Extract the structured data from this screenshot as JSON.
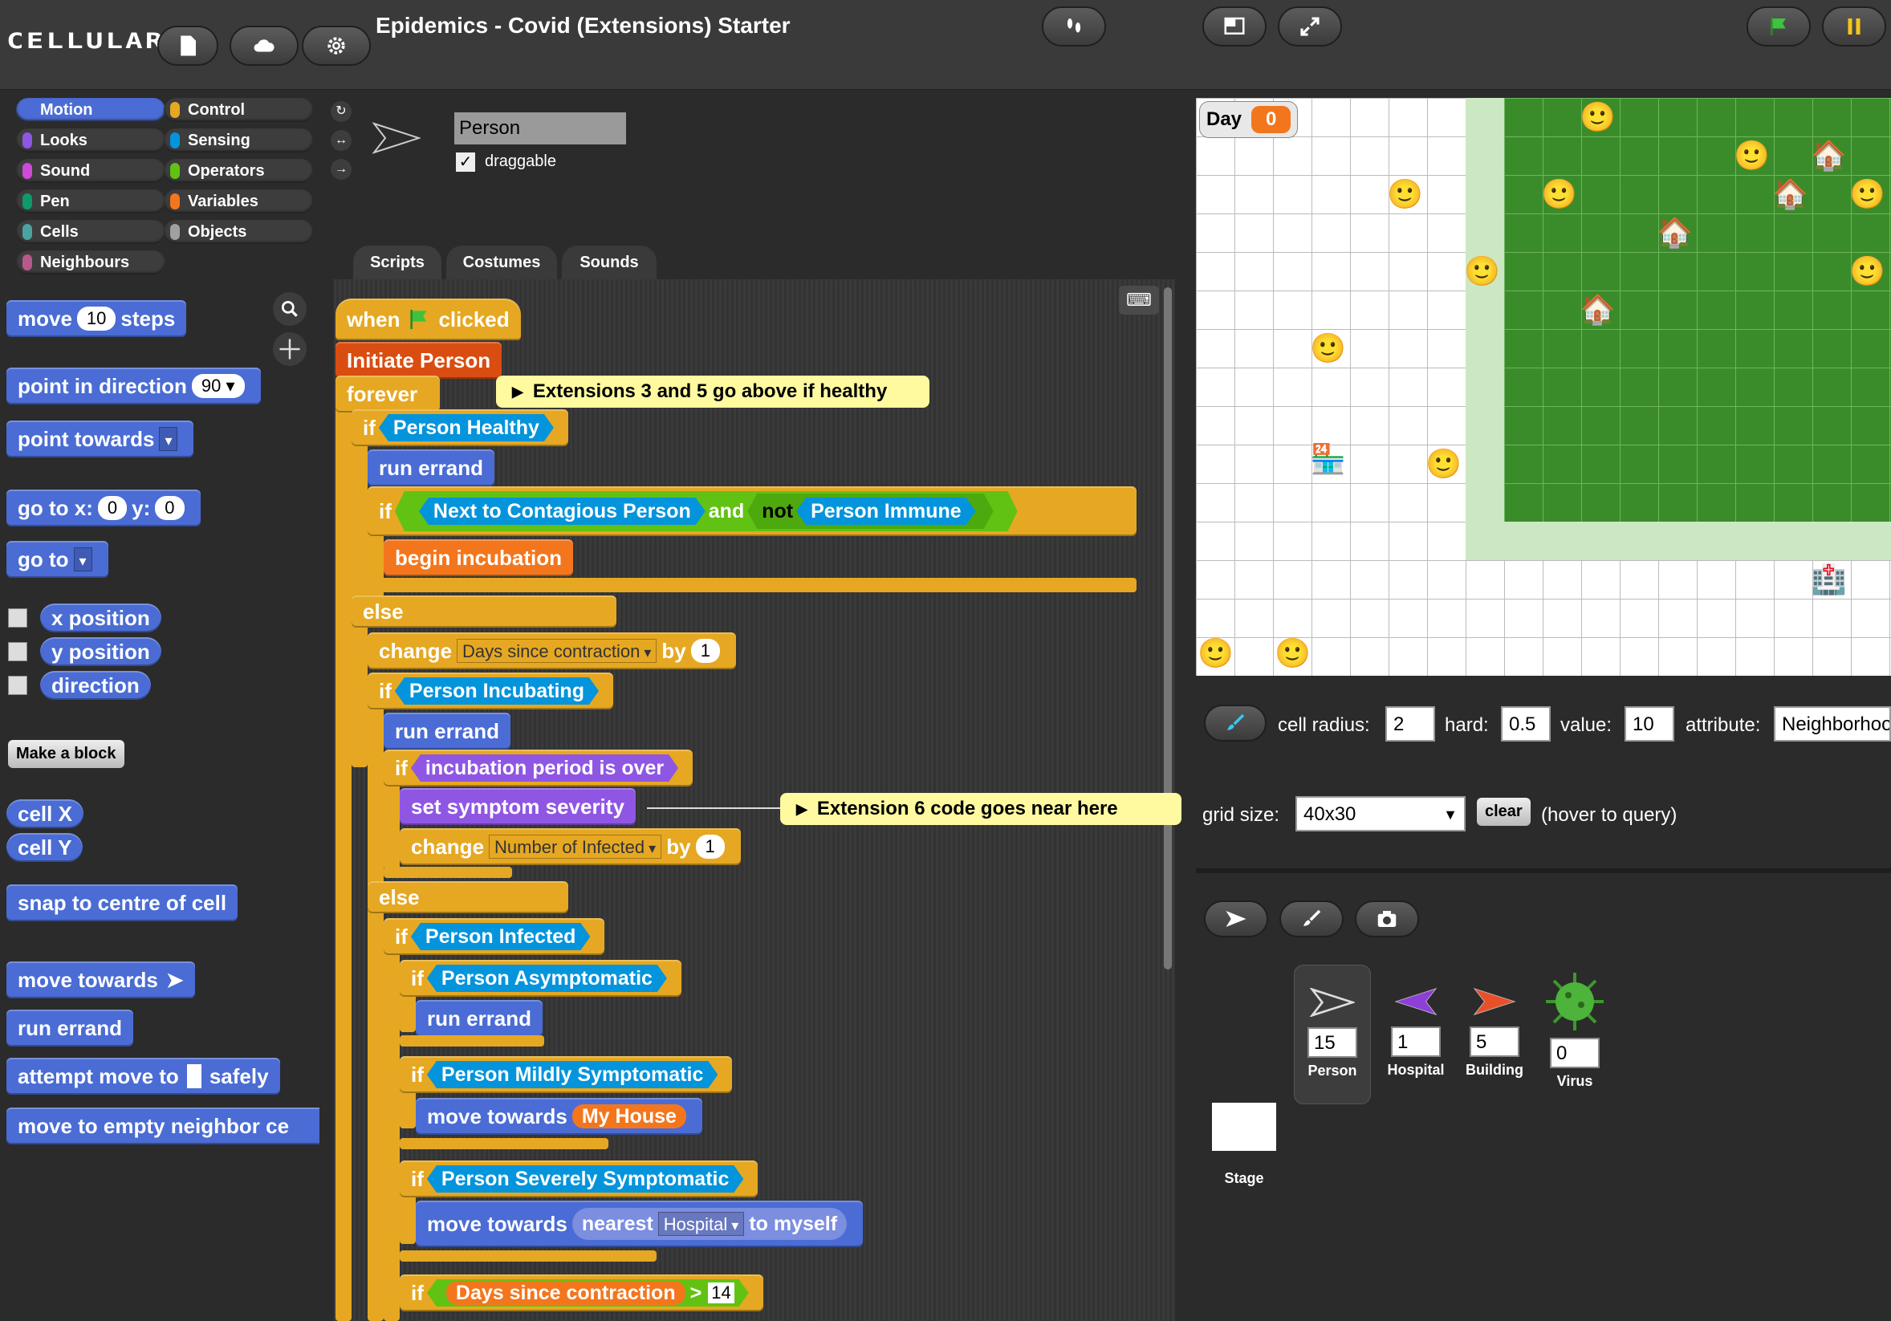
{
  "app": {
    "logo": "CELLULAR",
    "title": "Epidemics - Covid (Extensions) Starter"
  },
  "categories": [
    {
      "label": "Motion",
      "color": "#4a6cd4"
    },
    {
      "label": "Control",
      "color": "#e6a822"
    },
    {
      "label": "Looks",
      "color": "#8f56e3"
    },
    {
      "label": "Sensing",
      "color": "#0494dc"
    },
    {
      "label": "Sound",
      "color": "#cf4ad9"
    },
    {
      "label": "Operators",
      "color": "#62c213"
    },
    {
      "label": "Pen",
      "color": "#0e9a6c"
    },
    {
      "label": "Variables",
      "color": "#f3761d"
    },
    {
      "label": "Cells",
      "color": "#4aa3a0"
    },
    {
      "label": "Objects",
      "color": "#a0a0a0"
    },
    {
      "label": "Neighbours",
      "color": "#b75a8a"
    }
  ],
  "palette": {
    "move": "move",
    "move_val": "10",
    "steps": "steps",
    "point_dir": "point in direction",
    "point_dir_val": "90",
    "point_towards": "point towards",
    "goto_x": "go to x:",
    "x_val": "0",
    "y_lbl": "y:",
    "y_val": "0",
    "goto": "go to",
    "x_position": "x position",
    "y_position": "y position",
    "direction": "direction",
    "make_block": "Make a block",
    "cell_x": "cell X",
    "cell_y": "cell Y",
    "snap": "snap to centre of cell",
    "move_towards": "move towards",
    "run_errand": "run errand",
    "attempt_pre": "attempt move to",
    "attempt_post": "safely",
    "move_empty": "move to empty neighbor ce"
  },
  "sprite": {
    "name": "Person",
    "draggable": "draggable"
  },
  "tabs": [
    "Scripts",
    "Costumes",
    "Sounds"
  ],
  "script": {
    "when": "when",
    "clicked": "clicked",
    "initiate": "Initiate Person",
    "forever": "forever",
    "comment1": "Extensions 3 and 5 go above if healthy",
    "if": "if",
    "person_healthy": "Person Healthy",
    "run_errand": "run errand",
    "next_contagious": "Next to Contagious Person",
    "and": "and",
    "not": "not",
    "person_immune": "Person Immune",
    "begin_incubation": "begin incubation",
    "else": "else",
    "change": "change",
    "days_since": "Days since contraction",
    "by": "by",
    "by_val": "1",
    "person_incubating": "Person Incubating",
    "incubation_over": "incubation period is over",
    "set_symptom": "set symptom severity",
    "comment2": "Extension 6 code goes near here",
    "number_infected": "Number of Infected",
    "by_val2": "1",
    "person_infected": "Person Infected",
    "person_asym": "Person Asymptomatic",
    "person_mild": "Person Mildly Symptomatic",
    "move_towards": "move towards",
    "my_house": "My House",
    "person_severe": "Person Severely Symptomatic",
    "nearest": "nearest",
    "hospital": "Hospital",
    "to_myself": "to myself",
    "gt": ">",
    "gt_val": "14"
  },
  "stage": {
    "day_label": "Day",
    "day_value": "0"
  },
  "controls": {
    "cell_radius": "cell radius:",
    "cell_radius_val": "2",
    "hard": "hard:",
    "hard_val": "0.5",
    "value": "value:",
    "value_val": "10",
    "attribute": "attribute:",
    "attribute_val": "Neighborhoo",
    "grid_size": "grid size:",
    "grid_size_val": "40x30",
    "clear": "clear",
    "hover": "(hover to query)"
  },
  "sprites": [
    {
      "name": "Person",
      "count": "15"
    },
    {
      "name": "Hospital",
      "count": "1"
    },
    {
      "name": "Building",
      "count": "5"
    },
    {
      "name": "Virus",
      "count": "0"
    }
  ],
  "stage_label": "Stage"
}
